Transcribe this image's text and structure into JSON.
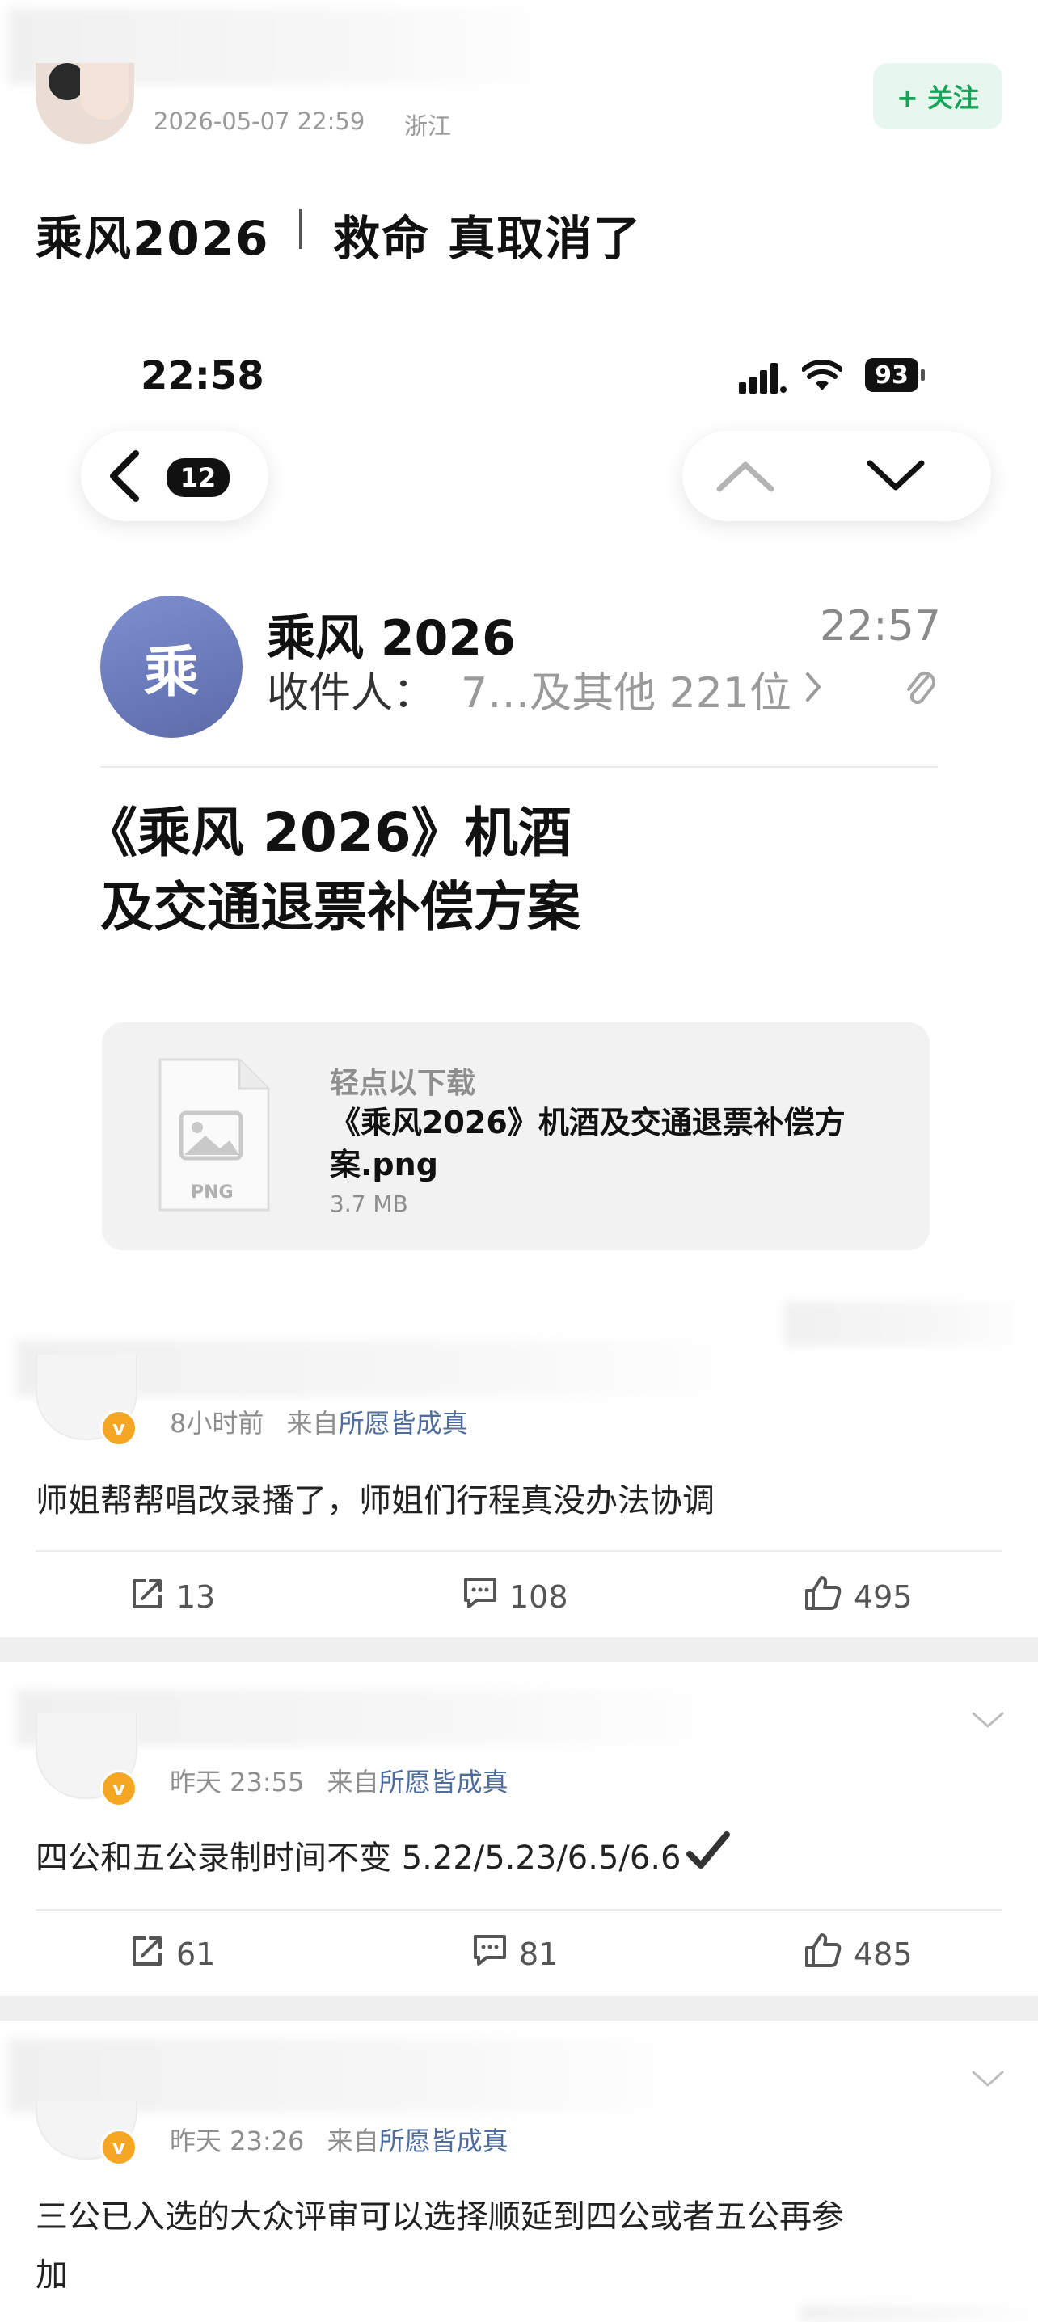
{
  "post": {
    "timestamp": "2026-05-07 22:59",
    "location": "浙江",
    "follow_label": "+ 关注",
    "title_left": "乘风2026",
    "title_right": "救命 真取消了"
  },
  "phone": {
    "time": "22:58",
    "battery": "93",
    "unread_count": "12"
  },
  "mail": {
    "avatar_char": "乘",
    "sender": "乘风 2026",
    "time": "22:57",
    "recipient_label": "收件人：",
    "recipients": "7…及其他 221位",
    "subject_line1": "《乘风 2026》机酒",
    "subject_line2": "及交通退票补偿方案",
    "attachment": {
      "hint": "轻点以下载",
      "name": "《乘风2026》机酒及交通退票补偿方案.png",
      "size": "3.7 MB",
      "type": "PNG"
    }
  },
  "comments": [
    {
      "time": "8小时前",
      "from_label": "来自",
      "source": "所愿皆成真",
      "text": "师姐帮帮唱改录播了，师姐们行程真没办法协调",
      "shares": "13",
      "replies": "108",
      "likes": "495"
    },
    {
      "time": "昨天 23:55",
      "from_label": "来自",
      "source": "所愿皆成真",
      "text": "四公和五公录制时间不变 5.22/5.23/6.5/6.6",
      "shares": "61",
      "replies": "81",
      "likes": "485"
    },
    {
      "time": "昨天 23:26",
      "from_label": "来自",
      "source": "所愿皆成真",
      "text_line1": "三公已入选的大众评审可以选择顺延到四公或者五公再参",
      "text_line2": "加"
    }
  ],
  "colors": {
    "follow_green": "#19a35a",
    "source_blue": "#4e6c9c",
    "avatar_purple": "#6f7fbf",
    "vip_orange": "#f5a623"
  }
}
